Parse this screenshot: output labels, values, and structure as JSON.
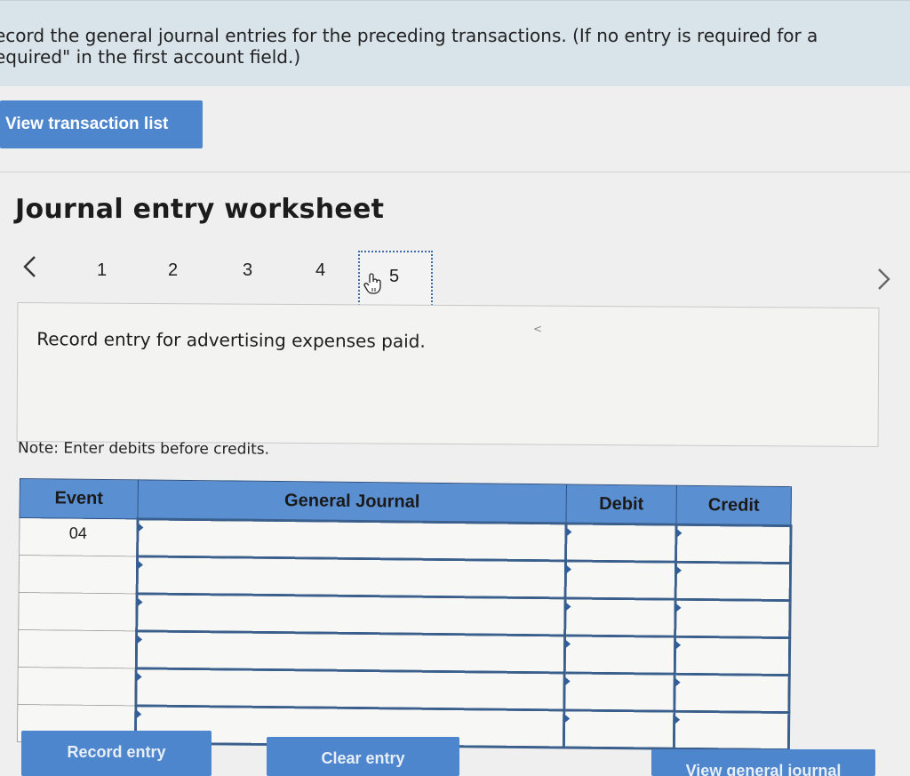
{
  "instructions": {
    "line1": "ecord the general journal entries for the preceding transactions. (If no entry is required for a",
    "line2": "equired\" in the first account field.)"
  },
  "buttons": {
    "view_transaction_list": "View transaction list",
    "record_entry": "Record entry",
    "clear_entry": "Clear entry",
    "view_general_journal": "View general journal"
  },
  "worksheet": {
    "title": "Journal entry worksheet",
    "pages": [
      "1",
      "2",
      "3",
      "4",
      "5"
    ],
    "active_page": "5",
    "prev_icon": "chevron-left-icon",
    "next_icon": "chevron-right-icon",
    "prompt": "Record entry for advertising expenses paid.",
    "note": "Note: Enter debits before credits."
  },
  "table": {
    "headers": {
      "event": "Event",
      "general_journal": "General Journal",
      "debit": "Debit",
      "credit": "Credit"
    },
    "rows": [
      {
        "event": "04",
        "account": "",
        "debit": "",
        "credit": ""
      },
      {
        "event": "",
        "account": "",
        "debit": "",
        "credit": ""
      },
      {
        "event": "",
        "account": "",
        "debit": "",
        "credit": ""
      },
      {
        "event": "",
        "account": "",
        "debit": "",
        "credit": ""
      },
      {
        "event": "",
        "account": "",
        "debit": "",
        "credit": ""
      },
      {
        "event": "",
        "account": "",
        "debit": "",
        "credit": ""
      }
    ]
  },
  "colors": {
    "accent_blue": "#4d86cc",
    "header_blue": "#5a8fd2",
    "instruction_bg": "#d9e3ea"
  }
}
